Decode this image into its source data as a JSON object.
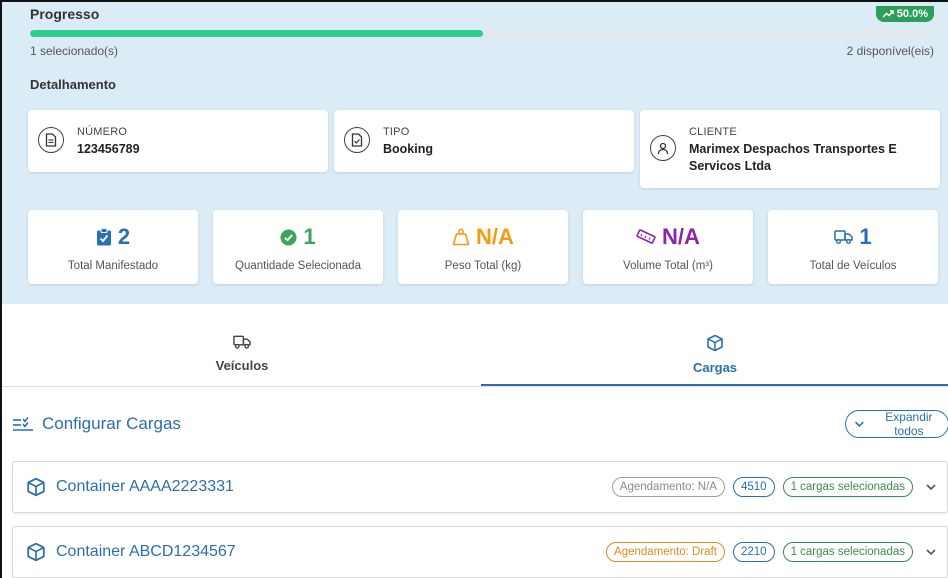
{
  "progress": {
    "title": "Progresso",
    "badge": "50.0%",
    "fraction": 0.5,
    "selected_text": "1 selecionado(s)",
    "available_text": "2 disponível(eis)"
  },
  "detail": {
    "heading": "Detalhamento",
    "number": {
      "label": "NÚMERO",
      "value": "123456789",
      "icon": "document-icon"
    },
    "type": {
      "label": "TIPO",
      "value": "Booking",
      "icon": "file-check-icon"
    },
    "client": {
      "label": "CLIENTE",
      "value": "Marimex Despachos Transportes E Servicos Ltda",
      "icon": "user-icon"
    }
  },
  "stats": [
    {
      "value": "2",
      "label": "Total Manifestado",
      "icon": "clipboard-check-icon",
      "color": "#2a6fb0"
    },
    {
      "value": "1",
      "label": "Quantidade Selecionada",
      "icon": "check-circle-icon",
      "color": "#3ca55c"
    },
    {
      "value": "N/A",
      "label": "Peso Total (kg)",
      "icon": "weight-icon",
      "color": "#f39c12"
    },
    {
      "value": "N/A",
      "label": "Volume Total (m³)",
      "icon": "ruler-icon",
      "color": "#8e24aa"
    },
    {
      "value": "1",
      "label": "Total de Veículos",
      "icon": "truck-icon",
      "color": "#2a6fb0"
    }
  ],
  "tabs": [
    {
      "label": "Veículos",
      "icon": "truck-icon",
      "active": false
    },
    {
      "label": "Cargas",
      "icon": "box-icon",
      "active": true
    }
  ],
  "config": {
    "title": "Configurar Cargas",
    "expand_label": "Expandir todos"
  },
  "containers": [
    {
      "name": "Container AAAA2223331",
      "schedule": "Agendamento: N/A",
      "code": "4510",
      "selected": "1 cargas selecionadas"
    },
    {
      "name": "Container ABCD1234567",
      "schedule": "Agendamento: Draft",
      "code": "2210",
      "selected": "1 cargas selecionadas"
    }
  ],
  "colors": {
    "accent": "#2a6fb0",
    "summary_bg": "#dcecf7",
    "progress_fill": "#2ecc8f",
    "badge_bg": "#2e9e5b"
  }
}
